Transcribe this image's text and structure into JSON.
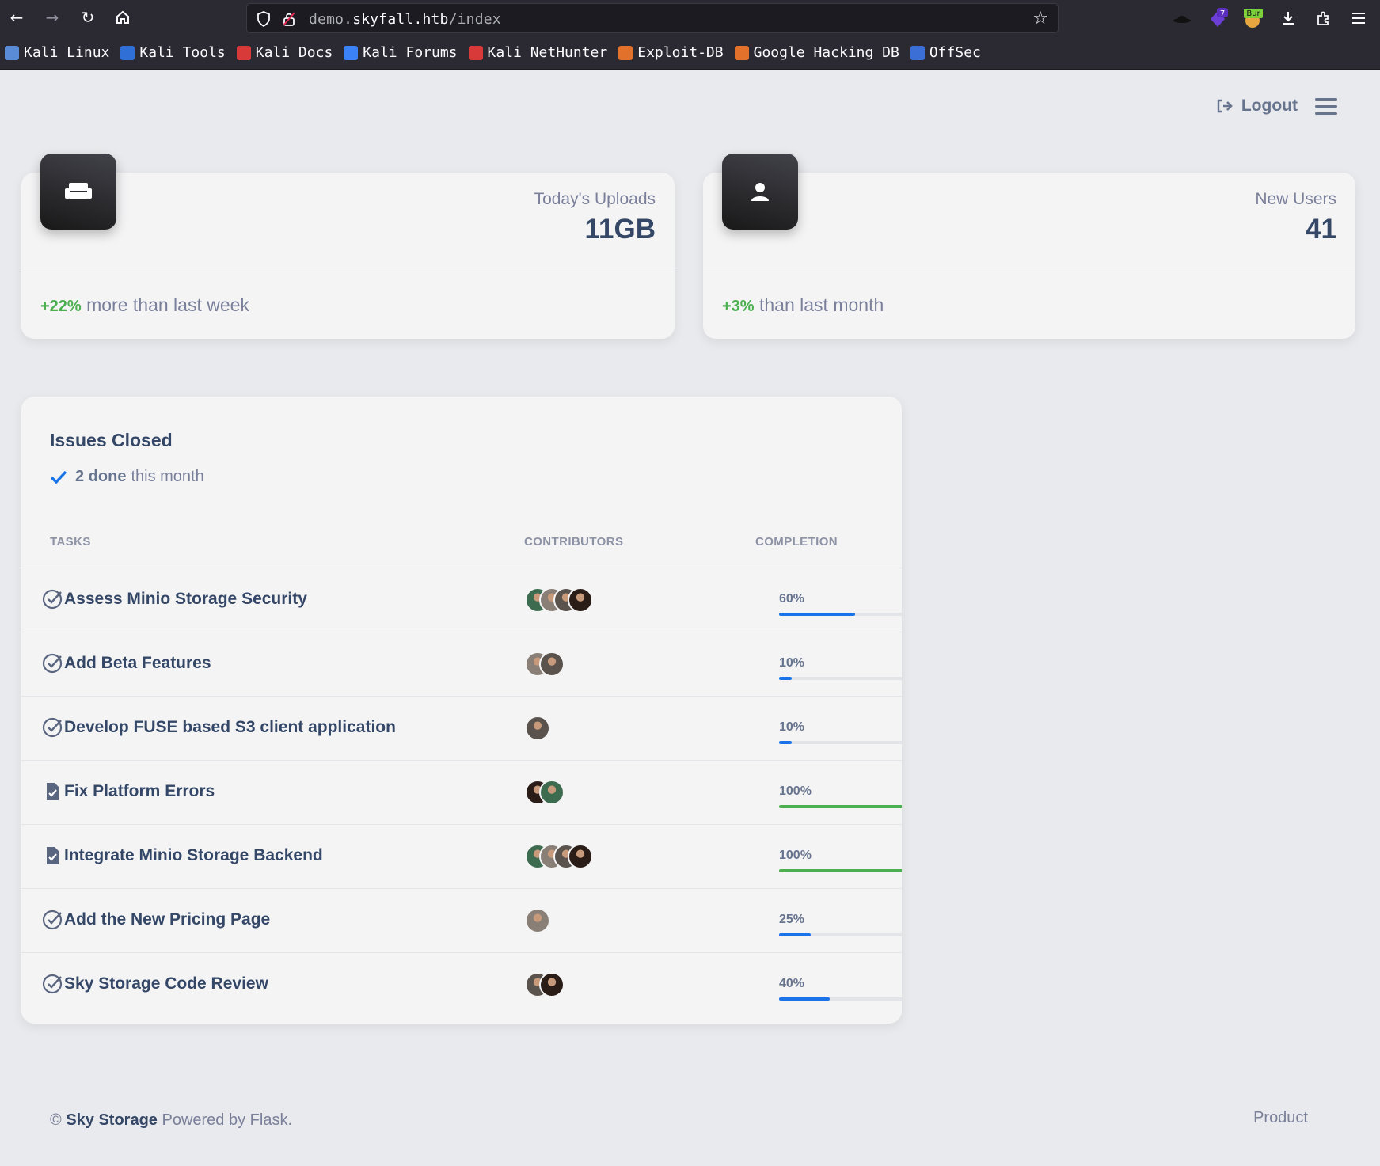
{
  "browser": {
    "url_prefix": "demo.",
    "url_domain": "skyfall.htb",
    "url_path": "/index",
    "extension_badge": "7",
    "burp_badge": "Bur",
    "bookmarks": [
      {
        "label": "Kali Linux",
        "color": "#5a8bd6"
      },
      {
        "label": "Kali Tools",
        "color": "#2f6fd6"
      },
      {
        "label": "Kali Docs",
        "color": "#d83a3a"
      },
      {
        "label": "Kali Forums",
        "color": "#3b82f6"
      },
      {
        "label": "Kali NetHunter",
        "color": "#d83a3a"
      },
      {
        "label": "Exploit-DB",
        "color": "#e2712b"
      },
      {
        "label": "Google Hacking DB",
        "color": "#e2712b"
      },
      {
        "label": "OffSec",
        "color": "#3b6fd6"
      }
    ]
  },
  "header": {
    "logout_label": "Logout"
  },
  "stats": [
    {
      "label": "Today's Uploads",
      "value": "11GB",
      "change": "+22%",
      "footer": " more than last week",
      "icon": "couch-icon"
    },
    {
      "label": "New Users",
      "value": "41",
      "change": "+3%",
      "footer": " than last month",
      "icon": "user-icon"
    }
  ],
  "issues": {
    "title": "Issues Closed",
    "done_count": "2 done",
    "done_suffix": "this month",
    "columns": [
      "TASKS",
      "CONTRIBUTORS",
      "COMPLETION"
    ],
    "rows": [
      {
        "task": "Assess Minio Storage Security",
        "icon": "check-circle-icon",
        "contributors": 4,
        "completion_label": "60%",
        "completion": 0.6
      },
      {
        "task": "Add Beta Features",
        "icon": "check-circle-icon",
        "contributors": 2,
        "completion_label": "10%",
        "completion": 0.1
      },
      {
        "task": "Develop FUSE based S3 client application",
        "icon": "check-circle-icon",
        "contributors": 1,
        "completion_label": "10%",
        "completion": 0.1
      },
      {
        "task": "Fix Platform Errors",
        "icon": "document-check-icon",
        "contributors": 2,
        "completion_label": "100%",
        "completion": 1.0
      },
      {
        "task": "Integrate Minio Storage Backend",
        "icon": "document-check-icon",
        "contributors": 4,
        "completion_label": "100%",
        "completion": 1.0
      },
      {
        "task": "Add the New Pricing Page",
        "icon": "check-circle-icon",
        "contributors": 1,
        "completion_label": "25%",
        "completion": 0.25
      },
      {
        "task": "Sky Storage Code Review",
        "icon": "check-circle-icon",
        "contributors": 2,
        "completion_label": "40%",
        "completion": 0.4
      }
    ]
  },
  "footer": {
    "copyright": "©",
    "brand": "Sky Storage",
    "powered": "Powered by Flask.",
    "link": "Product"
  },
  "colors": {
    "progress_partial": "#1a73e8",
    "progress_complete": "#4caf50",
    "change_positive": "#4caf50"
  }
}
